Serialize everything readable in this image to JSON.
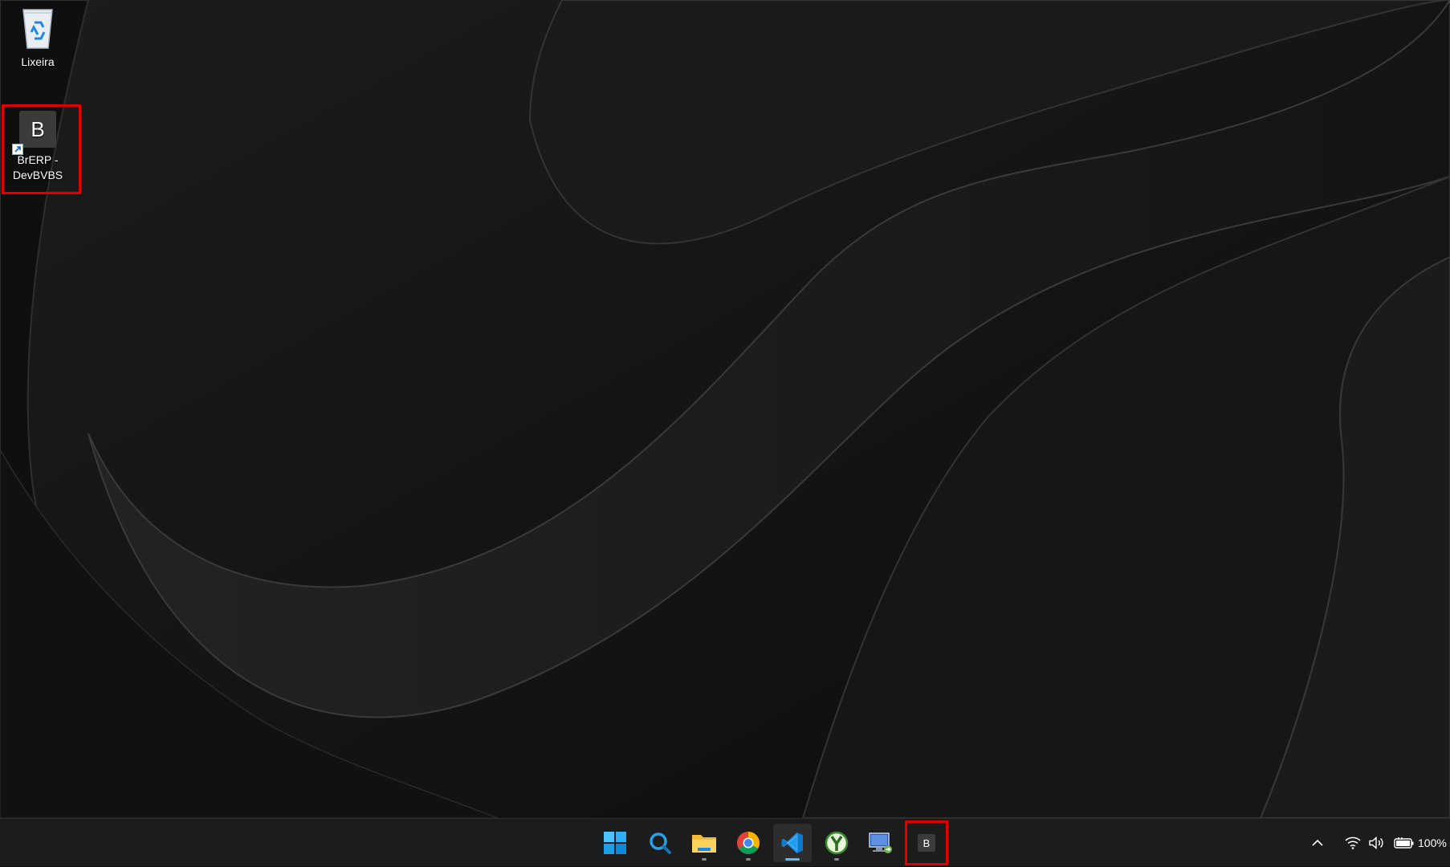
{
  "desktop": {
    "icons": [
      {
        "label": "Lixeira",
        "icon": "recycle-bin-icon"
      },
      {
        "label": "BrERP -\nDevBVBS",
        "icon": "brerp-app-icon",
        "letter": "B",
        "shortcut": true,
        "highlighted": true
      }
    ]
  },
  "taskbar": {
    "apps": [
      {
        "name": "Start",
        "icon": "windows-start-icon",
        "running": false
      },
      {
        "name": "Search",
        "icon": "search-icon",
        "running": false
      },
      {
        "name": "File Explorer",
        "icon": "file-explorer-icon",
        "running": true
      },
      {
        "name": "Google Chrome",
        "icon": "chrome-icon",
        "running": true
      },
      {
        "name": "Visual Studio Code",
        "icon": "vscode-icon",
        "running": true,
        "active": true
      },
      {
        "name": "Cygwin",
        "icon": "cygwin-icon",
        "running": true
      },
      {
        "name": "Remote Desktop",
        "icon": "remote-desktop-icon",
        "running": false
      },
      {
        "name": "BrERP",
        "icon": "brerp-taskbar-icon",
        "letter": "B",
        "running": false,
        "highlighted": true
      }
    ],
    "tray": {
      "battery_percent": "100%",
      "icons": [
        "chevron-up-icon",
        "wifi-icon",
        "volume-icon",
        "battery-charging-icon"
      ]
    }
  },
  "colors": {
    "highlight": "#e00000",
    "taskbar_bg": "#1c1c1c",
    "active_indicator": "#4cc2ff"
  }
}
